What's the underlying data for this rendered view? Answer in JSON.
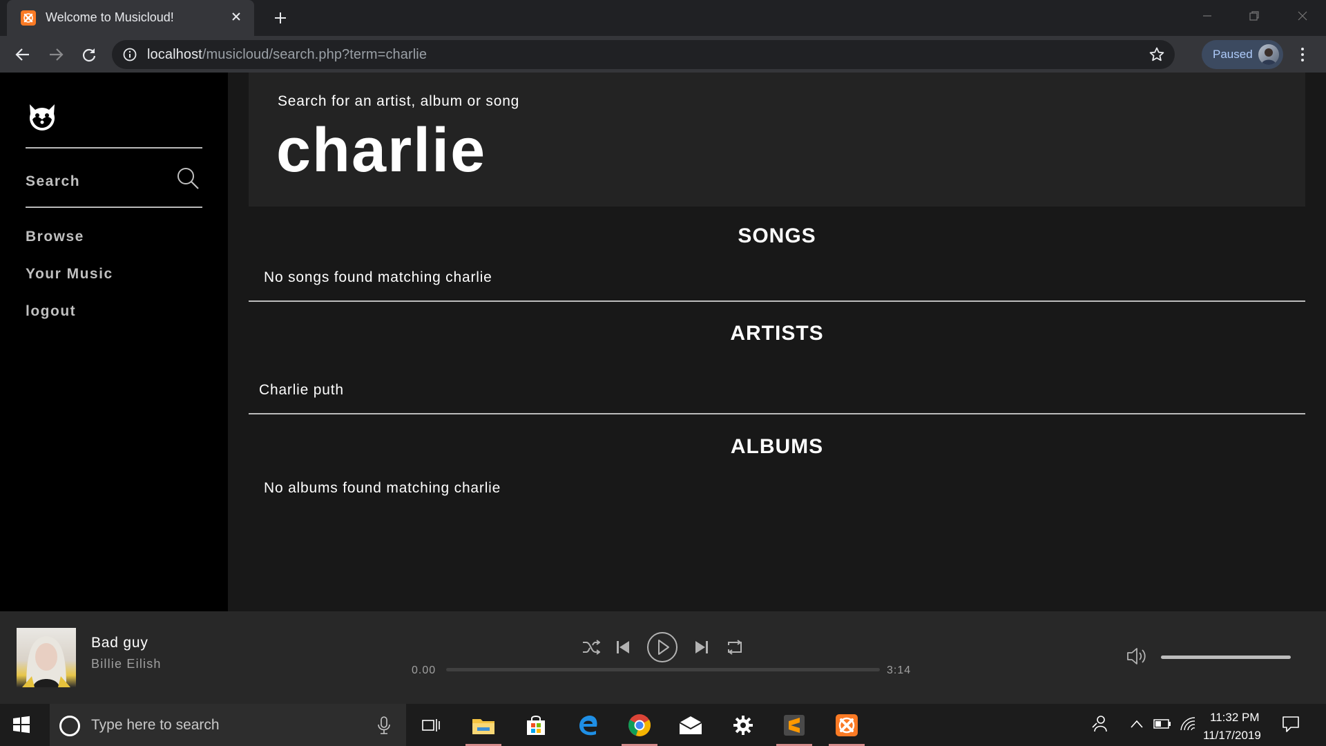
{
  "browser": {
    "tab_title": "Welcome to Musicloud!",
    "url_host": "localhost",
    "url_path": "/musicloud/search.php?term=charlie",
    "profile_label": "Paused"
  },
  "sidebar": {
    "search_label": "Search",
    "nav": [
      {
        "label": "Browse"
      },
      {
        "label": "Your Music"
      },
      {
        "label": "logout"
      }
    ]
  },
  "search": {
    "hint": "Search for an artist, album or song",
    "term": "charlie"
  },
  "sections": {
    "songs": {
      "title": "SONGS",
      "message": "No songs found matching charlie"
    },
    "artists": {
      "title": "ARTISTS",
      "results": [
        "Charlie puth"
      ]
    },
    "albums": {
      "title": "ALBUMS",
      "message": "No albums found matching charlie"
    }
  },
  "player": {
    "track_title": "Bad guy",
    "artist": "Billie Eilish",
    "time_current": "0.00",
    "time_total": "3:14",
    "progress_fraction": 0,
    "volume_fraction": 1
  },
  "taskbar": {
    "search_placeholder": "Type here to search",
    "time": "11:32 PM",
    "date": "11/17/2019"
  },
  "colors": {
    "sidebar_bg": "#000000",
    "main_bg": "#181818",
    "search_box_bg": "#232323",
    "player_bg": "#282828",
    "xampp_orange": "#fb7a24"
  }
}
